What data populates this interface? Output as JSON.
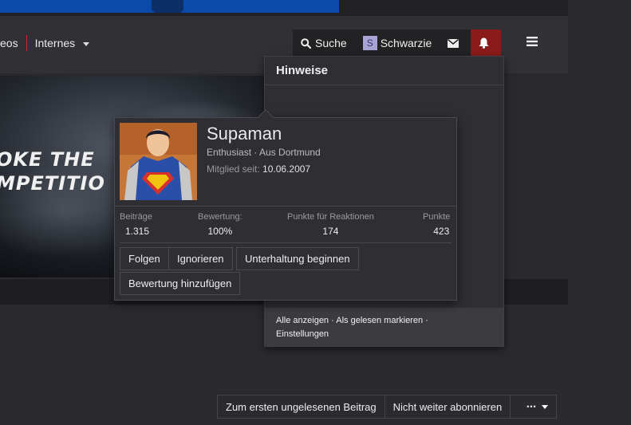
{
  "nav": {
    "videos_partial": "eos",
    "internes": "Internes",
    "search": "Suche",
    "user_initial": "S",
    "username": "Schwarzie"
  },
  "banner": {
    "line1": "OKE THE",
    "line2": "MPETITIO"
  },
  "notifications": {
    "title": "Hinweise",
    "show_all": "Alle anzeigen",
    "mark_read": "Als gelesen markieren",
    "settings": "Einstellungen",
    "sep": "·"
  },
  "member": {
    "name": "Supaman",
    "title": "Enthusiast · Aus Dortmund",
    "since_label": "Mitglied seit:",
    "since_value": "10.06.2007",
    "stats": [
      {
        "label": "Beiträge",
        "value": "1.315"
      },
      {
        "label": "Bewertung:",
        "value": "100%"
      },
      {
        "label": "Punkte für Reaktionen",
        "value": "174"
      },
      {
        "label": "Punkte",
        "value": "423"
      }
    ],
    "buttons": {
      "follow": "Folgen",
      "ignore": "Ignorieren",
      "conversation": "Unterhaltung beginnen",
      "rate": "Bewertung hinzufügen"
    }
  },
  "thread_buttons": {
    "first_unread": "Zum ersten ungelesenen Beitrag",
    "unwatch": "Nicht weiter abonnieren",
    "more": "•••"
  },
  "colors": {
    "accent_red": "#d32626",
    "bell_bg": "#8b1a1a",
    "banner_blue": "#0b4aa8"
  },
  "icons": [
    "search-icon",
    "envelope-icon",
    "bell-icon",
    "hamburger-icon",
    "chevron-down-icon"
  ]
}
